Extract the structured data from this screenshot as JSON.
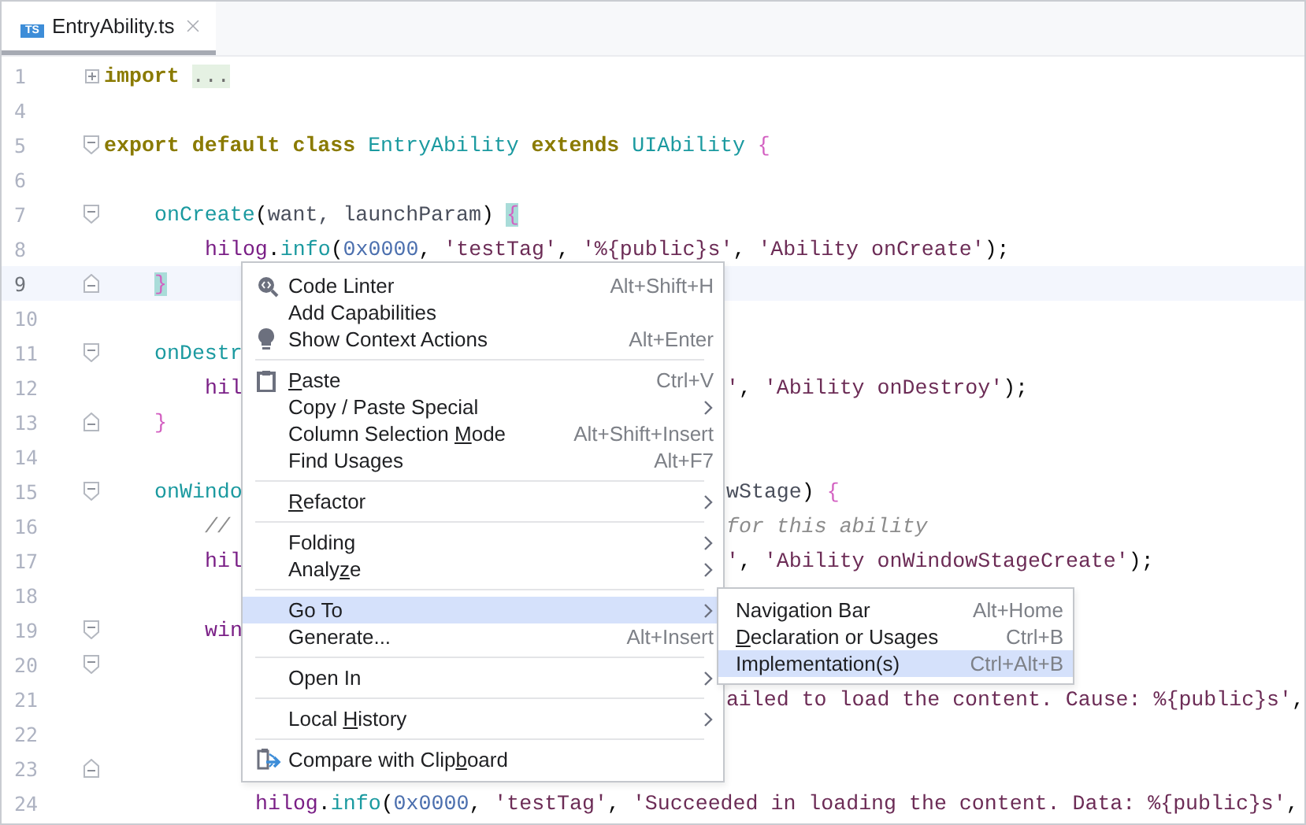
{
  "tabs": [
    {
      "label": "EntryAbility.ts",
      "icon_text": "TS",
      "selected": true
    }
  ],
  "lines": [
    {
      "number": "1",
      "folded": true,
      "current": false,
      "code": [
        {
          "kind": "kw",
          "text": "import",
          "space_after": true
        },
        {
          "kind": "folded",
          "text": "..."
        }
      ]
    },
    {
      "number": "4",
      "current": false
    },
    {
      "number": "5",
      "fold_start": true,
      "current": false,
      "code": [
        {
          "kind": "kw",
          "text": "export default class",
          "space_after": true
        },
        {
          "kind": "cls",
          "text": "EntryAbility",
          "space_after": true
        },
        {
          "kind": "kw",
          "text": "extends",
          "space_after": true
        },
        {
          "kind": "cls",
          "text": "UIAbility",
          "space_after": true
        },
        {
          "kind": "brace",
          "text": "{"
        }
      ],
      "children": [
        {
          "number": "6",
          "current": false
        },
        {
          "number": "7",
          "fold_start": true,
          "current": false,
          "code": [
            {
              "kind": "fn",
              "text": "onCreate"
            },
            {
              "kind": "punc",
              "text": "("
            },
            {
              "kind": "param",
              "text": "want, launchParam"
            },
            {
              "kind": "punc",
              "text": ") "
            },
            {
              "kind": "brace_match",
              "text": "{"
            }
          ],
          "children": [
            {
              "number": "8",
              "current": false,
              "code": [
                {
                  "kind": "obj",
                  "text": "hilog"
                },
                {
                  "kind": "punc",
                  "text": "."
                },
                {
                  "kind": "fn",
                  "text": "info"
                },
                {
                  "kind": "punc",
                  "text": "("
                },
                {
                  "kind": "num",
                  "text": "0x0000"
                },
                {
                  "kind": "punc",
                  "text": ", "
                },
                {
                  "kind": "str",
                  "text": "'testTag'"
                },
                {
                  "kind": "punc",
                  "text": ", "
                },
                {
                  "kind": "str",
                  "text": "'%{public}s'"
                },
                {
                  "kind": "punc",
                  "text": ", "
                },
                {
                  "kind": "str",
                  "text": "'Ability onCreate'"
                },
                {
                  "kind": "punc",
                  "text": ");"
                }
              ]
            }
          ]
        },
        {
          "number": "9",
          "fold_end": true,
          "current": true,
          "code": [
            {
              "kind": "brace_match",
              "text": "}"
            }
          ]
        },
        {
          "number": "10",
          "current": false
        },
        {
          "number": "11",
          "fold_start": true,
          "current": false,
          "code": [
            {
              "kind": "fn",
              "text": "onDestr"
            }
          ],
          "children": [
            {
              "number": "12",
              "current": false,
              "code": [
                {
                  "kind": "obj",
                  "text": "hil"
                }
              ],
              "after_menu": [
                {
                  "kind": "str",
                  "text": "'"
                },
                {
                  "kind": "punc",
                  "text": ", "
                },
                {
                  "kind": "str",
                  "text": "'Ability onDestroy'"
                },
                {
                  "kind": "punc",
                  "text": ");"
                }
              ]
            }
          ]
        },
        {
          "number": "13",
          "fold_end": true,
          "current": false,
          "code": [
            {
              "kind": "brace",
              "text": "}"
            }
          ]
        },
        {
          "number": "14",
          "current": false
        },
        {
          "number": "15",
          "fold_start": true,
          "current": false,
          "code": [
            {
              "kind": "fn",
              "text": "onWindo"
            }
          ],
          "after_menu": [
            {
              "kind": "param",
              "text": "wStage"
            },
            {
              "kind": "punc",
              "text": ") "
            },
            {
              "kind": "brace",
              "text": "{"
            }
          ],
          "children": [
            {
              "number": "16",
              "current": false,
              "code": [
                {
                  "kind": "comment",
                  "text": "//"
                }
              ],
              "after_menu": [
                {
                  "kind": "comment",
                  "text": "for this ability"
                }
              ]
            },
            {
              "number": "17",
              "current": false,
              "code": [
                {
                  "kind": "obj",
                  "text": "hil"
                }
              ],
              "after_menu": [
                {
                  "kind": "str",
                  "text": "'"
                },
                {
                  "kind": "punc",
                  "text": ", "
                },
                {
                  "kind": "str",
                  "text": "'Ability onWindowStageCreate'"
                },
                {
                  "kind": "punc",
                  "text": ");"
                }
              ]
            },
            {
              "number": "18",
              "current": false
            },
            {
              "number": "19",
              "fold_start": true,
              "current": false,
              "code": [
                {
                  "kind": "obj",
                  "text": "win"
                }
              ],
              "children": [
                {
                  "number": "20",
                  "fold_start": true,
                  "current": false,
                  "children": [
                    {
                      "number": "21",
                      "current": false,
                      "after_menu": [
                        {
                          "kind": "str",
                          "text": "ailed to load the content. Cause: %{public}s'"
                        },
                        {
                          "kind": "punc",
                          "text": ","
                        }
                      ]
                    },
                    {
                      "number": "22",
                      "current": false
                    }
                  ]
                },
                {
                  "number": "23",
                  "fold_end": true,
                  "current": false
                },
                {
                  "number": "24",
                  "current": false,
                  "code": [
                    {
                      "kind": "obj",
                      "text": "hilog"
                    },
                    {
                      "kind": "punc",
                      "text": "."
                    },
                    {
                      "kind": "fn",
                      "text": "info"
                    },
                    {
                      "kind": "punc",
                      "text": "("
                    },
                    {
                      "kind": "num",
                      "text": "0x0000"
                    },
                    {
                      "kind": "punc",
                      "text": ", "
                    },
                    {
                      "kind": "str",
                      "text": "'testTag'"
                    },
                    {
                      "kind": "punc",
                      "text": ", "
                    },
                    {
                      "kind": "str",
                      "text": "'Succeeded in loading the content. Data: %{public}s'"
                    },
                    {
                      "kind": "punc",
                      "text": ","
                    }
                  ]
                }
              ]
            }
          ]
        }
      ]
    }
  ],
  "context_menu": {
    "groups": [
      [
        {
          "label": "Code Linter",
          "shortcut": "Alt+Shift+H",
          "submenu": false,
          "selected": false
        },
        {
          "label": "Add Capabilities",
          "submenu": false,
          "selected": false
        },
        {
          "label": "Show Context Actions",
          "shortcut": "Alt+Enter",
          "submenu": false,
          "selected": false
        }
      ],
      [
        {
          "label_parts": {
            "key": "P",
            "after": "aste"
          },
          "shortcut": "Ctrl+V",
          "submenu": false,
          "selected": false
        },
        {
          "label": "Copy / Paste Special",
          "submenu": true,
          "selected": false
        },
        {
          "label_parts": {
            "before": "Column Selection ",
            "key": "M",
            "after": "ode"
          },
          "shortcut": "Alt+Shift+Insert",
          "submenu": false,
          "selected": false
        },
        {
          "label": "Find Usages",
          "shortcut": "Alt+F7",
          "submenu": false,
          "selected": false
        }
      ],
      [
        {
          "label_parts": {
            "key": "R",
            "after": "efactor"
          },
          "submenu": true,
          "selected": false
        }
      ],
      [
        {
          "label": "Folding",
          "submenu": true,
          "selected": false
        },
        {
          "label_parts": {
            "before": "Analy",
            "key": "z",
            "after": "e"
          },
          "submenu": true,
          "selected": false
        }
      ],
      [
        {
          "label": "Go To",
          "submenu": true,
          "selected": true
        },
        {
          "label": "Generate...",
          "shortcut": "Alt+Insert",
          "submenu": false,
          "selected": false
        }
      ],
      [
        {
          "label": "Open In",
          "submenu": true,
          "selected": false
        }
      ],
      [
        {
          "label_parts": {
            "before": "Local ",
            "key": "H",
            "after": "istory"
          },
          "submenu": true,
          "selected": false
        }
      ],
      [
        {
          "label_parts": {
            "before": "Compare with Clip",
            "key": "b",
            "after": "oard"
          },
          "submenu": false,
          "selected": false
        }
      ]
    ]
  },
  "submenu": {
    "items": [
      {
        "label": "Navigation Bar",
        "shortcut": "Alt+Home",
        "selected": false
      },
      {
        "label_parts": {
          "key": "D",
          "after": "eclaration or Usages"
        },
        "shortcut": "Ctrl+B",
        "selected": false
      },
      {
        "label": "Implementation(s)",
        "shortcut": "Ctrl+Alt+B",
        "selected": true
      }
    ]
  }
}
